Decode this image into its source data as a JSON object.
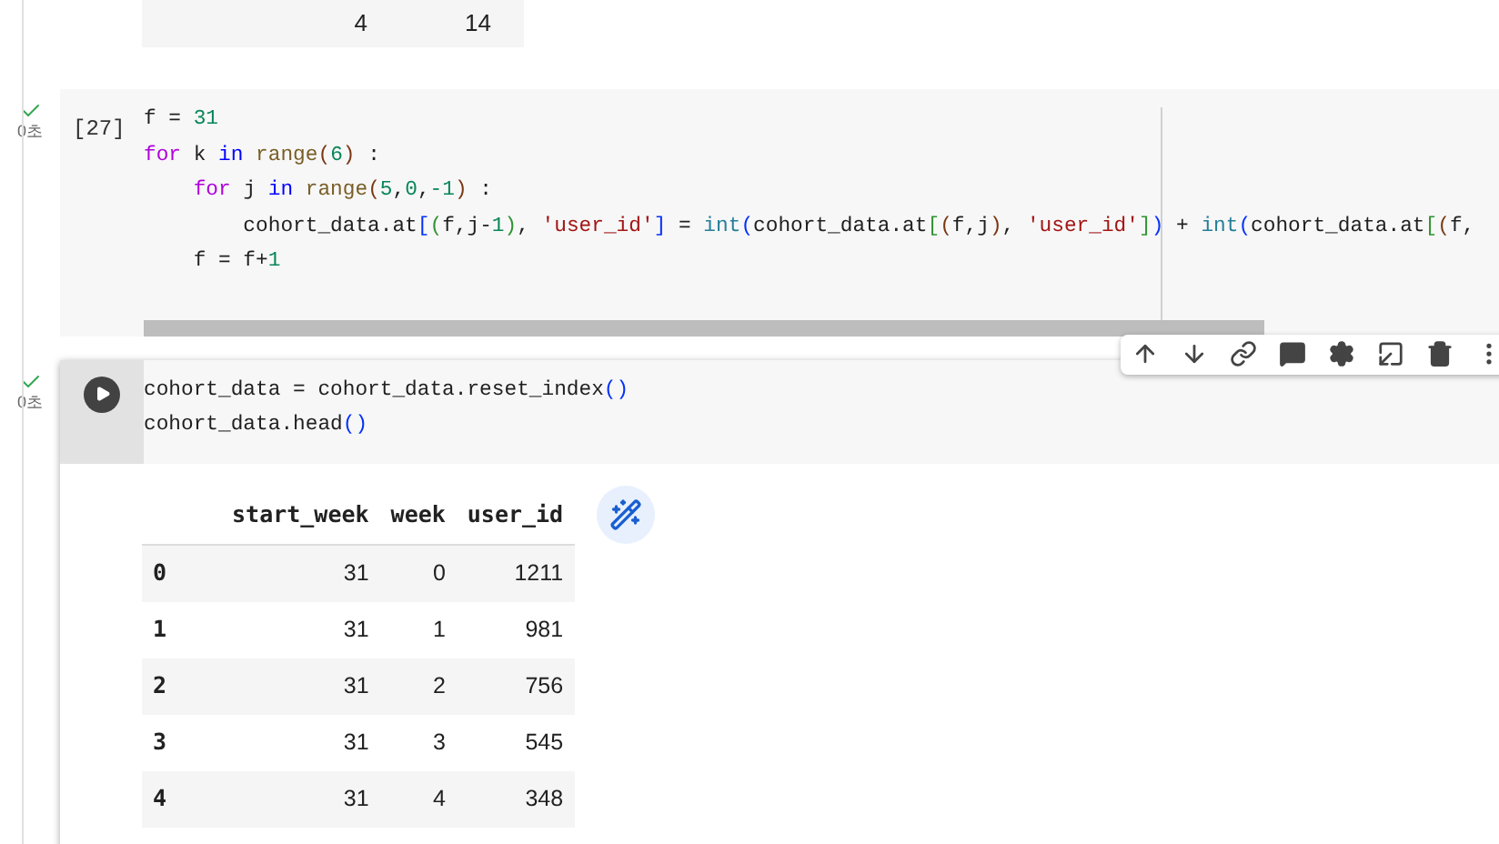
{
  "previous_output": {
    "rows": [
      {
        "cells": [
          "4",
          "14"
        ]
      }
    ]
  },
  "cells": [
    {
      "selected": false,
      "succeeded": true,
      "elapsed": "0초",
      "execution_count": "[27]",
      "ruler": true,
      "lines": [
        [
          {
            "kind": "plain",
            "text": "f = "
          },
          {
            "kind": "num",
            "text": "31"
          }
        ],
        [
          {
            "kind": "kw",
            "text": "for"
          },
          {
            "kind": "plain",
            "text": " k "
          },
          {
            "kind": "kin",
            "text": "in"
          },
          {
            "kind": "fn",
            "text": " range"
          },
          {
            "kind": "b3",
            "text": "("
          },
          {
            "kind": "num",
            "text": "6"
          },
          {
            "kind": "b3",
            "text": ")"
          },
          {
            "kind": "plain",
            "text": " :"
          }
        ],
        [
          {
            "kind": "kw",
            "text": "    for"
          },
          {
            "kind": "plain",
            "text": " j "
          },
          {
            "kind": "kin",
            "text": "in"
          },
          {
            "kind": "fn",
            "text": " range"
          },
          {
            "kind": "b3",
            "text": "("
          },
          {
            "kind": "num",
            "text": "5"
          },
          {
            "kind": "plain",
            "text": ","
          },
          {
            "kind": "num",
            "text": "0"
          },
          {
            "kind": "plain",
            "text": ","
          },
          {
            "kind": "num",
            "text": "-1"
          },
          {
            "kind": "b3",
            "text": ")"
          },
          {
            "kind": "plain",
            "text": " :"
          }
        ],
        [
          {
            "kind": "plain",
            "text": "        cohort_data.at"
          },
          {
            "kind": "b1",
            "text": "["
          },
          {
            "kind": "b2",
            "text": "("
          },
          {
            "kind": "plain",
            "text": "f,j-"
          },
          {
            "kind": "num",
            "text": "1"
          },
          {
            "kind": "b2",
            "text": ")"
          },
          {
            "kind": "plain",
            "text": ", "
          },
          {
            "kind": "str",
            "text": "'user_id'"
          },
          {
            "kind": "b1",
            "text": "]"
          },
          {
            "kind": "plain",
            "text": " = "
          },
          {
            "kind": "bi",
            "text": "int"
          },
          {
            "kind": "b1",
            "text": "("
          },
          {
            "kind": "plain",
            "text": "cohort_data.at"
          },
          {
            "kind": "b2",
            "text": "["
          },
          {
            "kind": "b3",
            "text": "("
          },
          {
            "kind": "plain",
            "text": "f,j"
          },
          {
            "kind": "b3",
            "text": ")"
          },
          {
            "kind": "plain",
            "text": ", "
          },
          {
            "kind": "str",
            "text": "'user_id'"
          },
          {
            "kind": "b2",
            "text": "]"
          },
          {
            "kind": "b1",
            "text": ")"
          },
          {
            "kind": "plain",
            "text": " + "
          },
          {
            "kind": "bi",
            "text": "int"
          },
          {
            "kind": "b1",
            "text": "("
          },
          {
            "kind": "plain",
            "text": "cohort_data.at"
          },
          {
            "kind": "b2",
            "text": "["
          },
          {
            "kind": "b3",
            "text": "("
          },
          {
            "kind": "plain",
            "text": "f,"
          }
        ],
        [
          {
            "kind": "plain",
            "text": "    f = f+"
          },
          {
            "kind": "num",
            "text": "1"
          }
        ]
      ]
    },
    {
      "selected": true,
      "succeeded": true,
      "elapsed": "0초",
      "lines": [
        [
          {
            "kind": "plain",
            "text": "cohort_data = cohort_data.reset_index"
          },
          {
            "kind": "b1",
            "text": "()"
          }
        ],
        [
          {
            "kind": "plain",
            "text": "cohort_data.head"
          },
          {
            "kind": "b1",
            "text": "()"
          }
        ]
      ],
      "output": {
        "columns": [
          "start_week",
          "week",
          "user_id"
        ],
        "rows": [
          {
            "index": "0",
            "cells": [
              "31",
              "0",
              "1211"
            ]
          },
          {
            "index": "1",
            "cells": [
              "31",
              "1",
              "981"
            ]
          },
          {
            "index": "2",
            "cells": [
              "31",
              "2",
              "756"
            ]
          },
          {
            "index": "3",
            "cells": [
              "31",
              "3",
              "545"
            ]
          },
          {
            "index": "4",
            "cells": [
              "31",
              "4",
              "348"
            ]
          }
        ]
      }
    }
  ]
}
